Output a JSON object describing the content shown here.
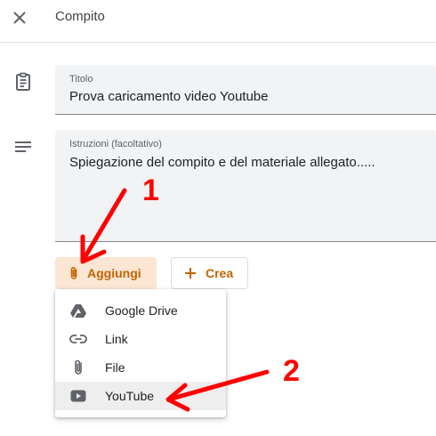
{
  "header": {
    "title": "Compito"
  },
  "title_field": {
    "label": "Titolo",
    "value": "Prova caricamento video Youtube"
  },
  "instructions_field": {
    "label": "Istruzioni (facoltativo)",
    "value": "Spiegazione del compito e del materiale allegato....."
  },
  "buttons": {
    "add_label": "Aggiungi",
    "create_label": "Crea"
  },
  "attach_menu": {
    "items": [
      {
        "label": "Google Drive",
        "icon": "google-drive-icon"
      },
      {
        "label": "Link",
        "icon": "link-icon"
      },
      {
        "label": "File",
        "icon": "paperclip-icon"
      },
      {
        "label": "YouTube",
        "icon": "youtube-icon"
      }
    ],
    "selected": "YouTube"
  },
  "annotations": {
    "step1": "1",
    "step2": "2"
  },
  "colors": {
    "accent": "#c26401",
    "accent_bg": "#fbe5d3",
    "annotation": "#ff0000",
    "field_bg": "#f1f3f4"
  }
}
